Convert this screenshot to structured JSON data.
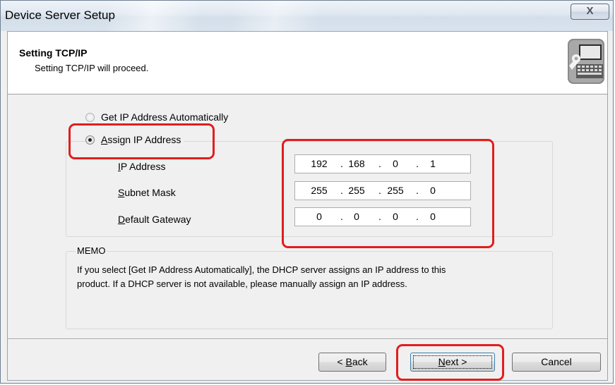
{
  "window": {
    "title": "Device Server Setup",
    "close_label": "X"
  },
  "header": {
    "title": "Setting TCP/IP",
    "subtitle": "Setting TCP/IP will proceed.",
    "icon": "computer-wrench-icon"
  },
  "options": {
    "auto": {
      "label": "Get IP Address Automatically",
      "selected": false
    },
    "assign": {
      "label_access": "A",
      "label_rest": "ssign IP Address",
      "selected": true
    }
  },
  "fields": {
    "ip": {
      "label_access": "I",
      "label_rest": "P Address",
      "octets": [
        "192",
        "168",
        "0",
        "1"
      ]
    },
    "subnet": {
      "label_access": "S",
      "label_rest": "ubnet Mask",
      "octets": [
        "255",
        "255",
        "255",
        "0"
      ]
    },
    "gateway": {
      "label_access": "D",
      "label_rest": "efault Gateway",
      "octets": [
        "0",
        "0",
        "0",
        "0"
      ]
    }
  },
  "memo": {
    "label": "MEMO",
    "line1": "If you select [Get IP Address Automatically], the DHCP server assigns an IP address to this",
    "line2": "product. If a DHCP server is not available, please manually assign an IP address."
  },
  "buttons": {
    "back_prefix": "< ",
    "back_access": "B",
    "back_rest": "ack",
    "next_access": "N",
    "next_rest": "ext >",
    "cancel": "Cancel"
  },
  "colors": {
    "highlight": "#e11e1e",
    "window_bg": "#f0f0f0"
  }
}
